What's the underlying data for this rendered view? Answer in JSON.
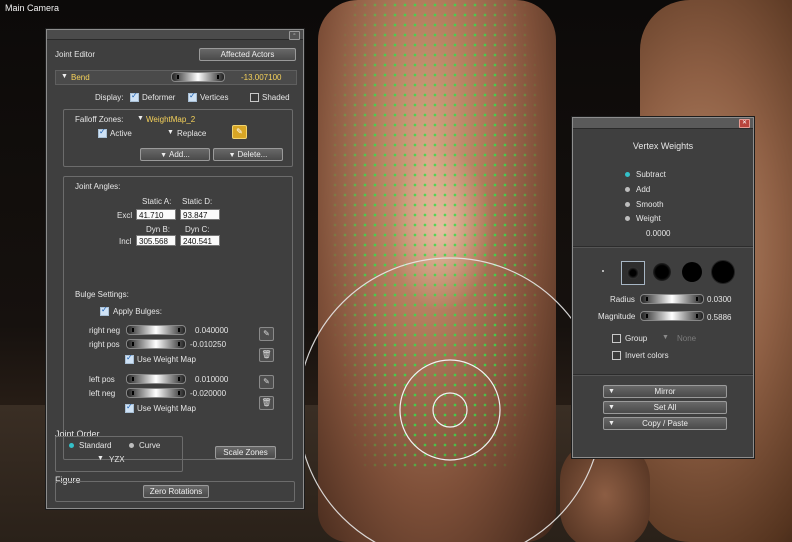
{
  "viewport": {
    "title": "Main Camera"
  },
  "joint_editor": {
    "title": "Joint Editor",
    "affected_actors_label": "Affected Actors",
    "parameter": {
      "name": "Bend",
      "value": "-13.007100"
    },
    "display": {
      "label": "Display:",
      "deformer": "Deformer",
      "vertices": "Vertices",
      "shaded": "Shaded"
    },
    "falloff": {
      "label": "Falloff Zones:",
      "map": "WeightMap_2",
      "active": "Active",
      "mode": "Replace",
      "add": "Add...",
      "delete": "Delete..."
    },
    "joint_angles": {
      "label": "Joint Angles:",
      "static_a": "Static A:",
      "static_d": "Static D:",
      "excl": "Excl",
      "excl_a": "41.710",
      "excl_d": "93.847",
      "dyn_b": "Dyn B:",
      "dyn_c": "Dyn C:",
      "incl": "Incl",
      "incl_b": "305.568",
      "incl_c": "240.541"
    },
    "bulge": {
      "label": "Bulge Settings:",
      "apply": "Apply Bulges:",
      "right_neg_label": "right neg",
      "right_neg": "0.040000",
      "right_pos_label": "right pos",
      "right_pos": "-0.010250",
      "use_weight_map": "Use Weight Map",
      "left_pos_label": "left pos",
      "left_pos": "0.010000",
      "left_neg_label": "left neg",
      "left_neg": "-0.020000"
    },
    "joint_order": {
      "label": "Joint Order",
      "standard": "Standard",
      "curve": "Curve",
      "order": "YZX",
      "scale_zones": "Scale Zones"
    },
    "figure": {
      "label": "Figure",
      "zero_rotations": "Zero Rotations"
    }
  },
  "vertex_weights": {
    "title": "Vertex Weights",
    "modes": [
      "Subtract",
      "Add",
      "Smooth",
      "Weight"
    ],
    "selected_mode": "Subtract",
    "weight_value": "0.0000",
    "radius_label": "Radius",
    "radius": "0.0300",
    "magnitude_label": "Magnitude",
    "magnitude": "0.5886",
    "group": "Group",
    "group_value": "None",
    "invert": "Invert colors",
    "mirror": "Mirror",
    "set_all": "Set All",
    "copy_paste": "Copy / Paste"
  },
  "colors": {
    "accent_teal": "#34c0c8",
    "vertex_dot": "#3cdc4c",
    "panel_bg": "#3f3f3f",
    "close_red": "#b9453d"
  }
}
